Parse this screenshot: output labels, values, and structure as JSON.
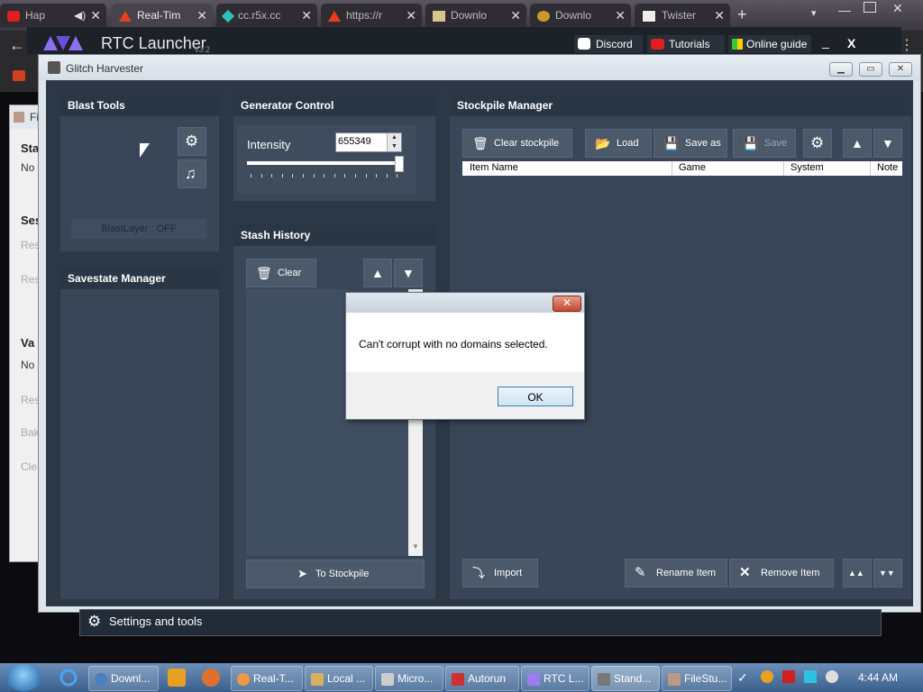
{
  "browser": {
    "tabs": [
      {
        "label": "Hap",
        "active": false
      },
      {
        "label": "Real-Tim",
        "active": true
      },
      {
        "label": "cc.r5x.cc",
        "active": false
      },
      {
        "label": "https://r",
        "active": false
      },
      {
        "label": "Downlo",
        "active": false
      },
      {
        "label": "Downlo",
        "active": false
      },
      {
        "label": "Twister",
        "active": false
      }
    ],
    "new_tab": "+"
  },
  "launcher": {
    "title": "RTC Launcher",
    "version": "v3.2",
    "discord": "Discord",
    "tutorials": "Tutorials",
    "online_guide": "Online guide",
    "minimize": "_",
    "close": "X"
  },
  "bg_window": {
    "title": "Fi",
    "section1": "Sta",
    "section1_value": "No",
    "section2": "Ses",
    "item_a": "Res",
    "item_b": "Res",
    "section3": "Va",
    "section3_value": "No",
    "item_c": "Res",
    "item_d": "Bak",
    "item_e": "Cle"
  },
  "glitch_harvester": {
    "title": "Glitch Harvester",
    "blast_tools": {
      "heading": "Blast Tools",
      "blast_layer": "BlastLayer : OFF"
    },
    "savestate": {
      "heading": "Savestate Manager"
    },
    "generator": {
      "heading": "Generator Control",
      "intensity_label": "Intensity",
      "intensity_value": "655349",
      "slider_level": 0.98
    },
    "stash": {
      "heading": "Stash History",
      "clear": "Clear",
      "to_stockpile": "To Stockpile"
    },
    "stockpile": {
      "heading": "Stockpile Manager",
      "clear_stockpile": "Clear stockpile",
      "load": "Load",
      "save_as": "Save as",
      "save": "Save",
      "columns": [
        "Item Name",
        "Game",
        "System",
        "Note"
      ],
      "import": "Import",
      "rename": "Rename Item",
      "remove": "Remove Item"
    },
    "settings_tools": "Settings and tools"
  },
  "dialog": {
    "message": "Can't corrupt with no domains selected.",
    "ok": "OK",
    "close": "✕"
  },
  "taskbar": {
    "items": [
      "Downl...",
      "Real-T...",
      "Local ...",
      "Micro...",
      "Autorun",
      "RTC L...",
      "Stand...",
      "FileStu..."
    ],
    "clock": "4:44 AM"
  },
  "colors": {
    "panel": "#384658",
    "panel_header": "#2b3645",
    "button": "#4b596b",
    "dialog_close": "#c4492f"
  }
}
